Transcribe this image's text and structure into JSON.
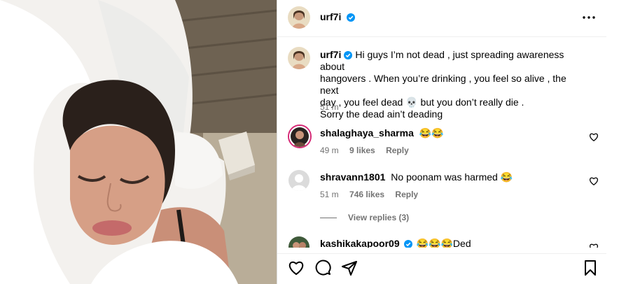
{
  "post": {
    "username": "urf7i",
    "verified": true,
    "photo_alt": "Woman lying on white pillows"
  },
  "caption": {
    "username": "urf7i",
    "text_line1": "Hi guys I’m not dead , just spreading awareness about",
    "text_line2": "hangovers . When you’re drinking , you feel so alive , the next",
    "text_line3a": "day , you feel dead",
    "text_line3_emoji": "💀",
    "text_line3b": "but you don’t really die .",
    "text_line4": "Sorry the dead ain’t deading",
    "time": "51 m"
  },
  "comments": [
    {
      "username": "shalaghaya_sharma",
      "text": "😂😂",
      "time": "49 m",
      "likes": "9 likes",
      "reply": "Reply"
    },
    {
      "username": "shravann1801",
      "text": "No poonam was harmed 😂",
      "time": "51 m",
      "likes": "746 likes",
      "reply": "Reply"
    },
    {
      "username": "kashikakapoor09",
      "verified": true,
      "text": "😂😂😂Ded"
    }
  ],
  "view_replies": "View replies (3)",
  "icons": {
    "more": "more-options-icon",
    "like": "heart-icon",
    "comment": "comment-icon",
    "share": "share-icon",
    "save": "bookmark-icon",
    "verified": "verified-badge-icon"
  },
  "colors": {
    "verified": "#0095f6",
    "meta": "#737373",
    "divider": "#efefef"
  }
}
